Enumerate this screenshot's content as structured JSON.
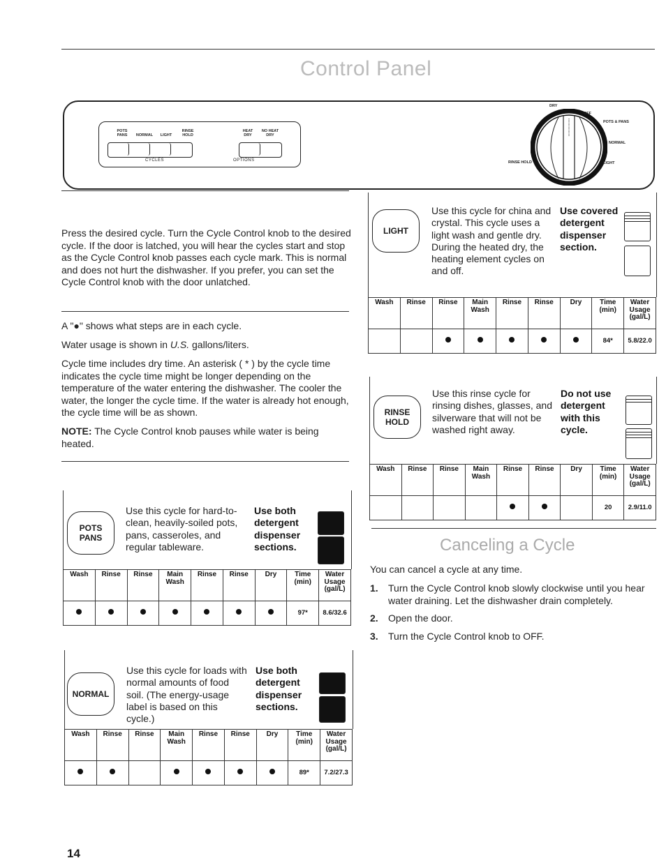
{
  "page": {
    "title": "Control Panel",
    "page_number": "14"
  },
  "control_panel": {
    "buttons": [
      {
        "label": "POTS PANS",
        "line1": "POTS",
        "line2": "PANS"
      },
      {
        "label": "NORMAL",
        "line1": "",
        "line2": "NORMAL"
      },
      {
        "label": "LIGHT",
        "line1": "",
        "line2": "LIGHT"
      },
      {
        "label": "RINSE HOLD",
        "line1": "RINSE",
        "line2": "HOLD"
      }
    ],
    "option_buttons": [
      {
        "label": "HEAT DRY",
        "line1": "HEAT",
        "line2": "DRY"
      },
      {
        "label": "NO HEAT DRY",
        "line1": "NO HEAT",
        "line2": "DRY"
      }
    ],
    "group_cycles": "CYCLES",
    "group_options": "OPTIONS",
    "dial": {
      "labels": {
        "dry": "DRY",
        "off": "OFF",
        "pots_pans": "POTS & PANS",
        "normal": "NORMAL",
        "light": "LIGHT",
        "rinse_hold": "RINSE HOLD"
      }
    }
  },
  "intro": {
    "paragraph1": "Press the desired cycle. Turn the Cycle Control knob to the desired cycle. If the door is latched, you will hear the cycles start and stop as the Cycle Control knob passes each cycle mark. This is normal and does not hurt the dishwasher. If you prefer, you can set the Cycle Control knob with the door unlatched.",
    "dot_note_prefix": "A \"",
    "dot_note_dot": "●",
    "dot_note_suffix": "\" shows what steps are in each cycle.",
    "water_prefix": "Water usage is shown in ",
    "water_us": "U.S.",
    "water_suffix": " gallons/liters.",
    "cycle_time": "Cycle time includes dry time. An asterisk ( * ) by the cycle time indicates the cycle time might be longer depending on the temperature of the water entering the dishwasher. The cooler the water, the longer the cycle time. If the water is already hot enough, the cycle time will be as shown.",
    "note_label": "NOTE:",
    "note_text": " The Cycle Control knob pauses while water is being heated."
  },
  "table_headers": [
    "Wash",
    "Rinse",
    "Rinse",
    "Main Wash",
    "Rinse",
    "Rinse",
    "Dry",
    "Time (min)",
    "Water Usage (gal/L)"
  ],
  "cycles": {
    "pots_pans": {
      "button_line1": "POTS",
      "button_line2": "PANS",
      "description": "Use this cycle for hard-to-clean, heavily-soiled pots, pans, casseroles, and regular tableware.",
      "detergent": "Use both detergent dispenser sections.",
      "steps": [
        true,
        true,
        true,
        true,
        true,
        true,
        true
      ],
      "time": "97*",
      "water": "8.6/32.6"
    },
    "normal": {
      "button_line1": "NORMAL",
      "button_line2": "",
      "description": "Use this cycle for loads with normal amounts of food soil. (The energy-usage label is based on this cycle.)",
      "detergent": "Use both detergent dispenser sections.",
      "steps": [
        true,
        true,
        false,
        true,
        true,
        true,
        true
      ],
      "time": "89*",
      "water": "7.2/27.3"
    },
    "light": {
      "button_line1": "LIGHT",
      "button_line2": "",
      "description": "Use this cycle for china and crystal. This cycle uses a light wash and gentle dry. During the heated dry, the heating element cycles on and off.",
      "detergent": "Use covered detergent dispenser section.",
      "steps": [
        false,
        false,
        true,
        true,
        true,
        true,
        true
      ],
      "time": "84*",
      "water": "5.8/22.0"
    },
    "rinse_hold": {
      "button_line1": "RINSE",
      "button_line2": "HOLD",
      "description": "Use this rinse cycle for rinsing dishes, glasses, and silverware that will not be washed right away.",
      "detergent": "Do not use detergent with this cycle.",
      "steps": [
        false,
        false,
        false,
        false,
        true,
        true,
        false
      ],
      "time": "20",
      "water": "2.9/11.0"
    }
  },
  "canceling": {
    "heading": "Canceling a Cycle",
    "intro": "You can cancel a cycle at any time.",
    "steps": [
      {
        "num": "1.",
        "text": "Turn the Cycle Control knob slowly clockwise until you hear water draining. Let the dishwasher drain completely."
      },
      {
        "num": "2.",
        "text": "Open the door."
      },
      {
        "num": "3.",
        "text": "Turn the Cycle Control knob to OFF."
      }
    ]
  }
}
